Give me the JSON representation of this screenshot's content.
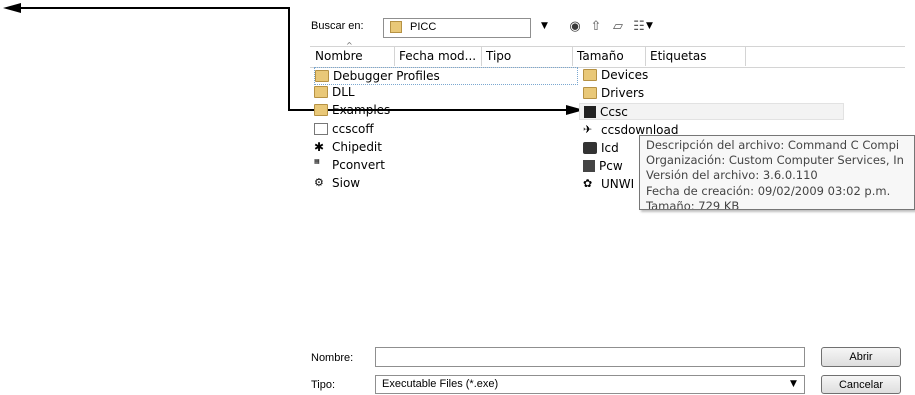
{
  "toolbar": {
    "lookin_label": "Buscar en:",
    "lookin_value": "PICC"
  },
  "columns": [
    "Nombre",
    "Fecha mod...",
    "Tipo",
    "Tamaño",
    "Etiquetas"
  ],
  "files_left": [
    {
      "name": "Debugger Profiles",
      "icon": "folder-icon"
    },
    {
      "name": "DLL",
      "icon": "folder-icon"
    },
    {
      "name": "Examples",
      "icon": "folder-icon"
    },
    {
      "name": "ccscoff",
      "icon": "exe-icon"
    },
    {
      "name": "Chipedit",
      "icon": "chip-icon"
    },
    {
      "name": "Pconvert",
      "icon": "convert-icon"
    },
    {
      "name": "Siow",
      "icon": "serial-icon"
    }
  ],
  "files_right": [
    {
      "name": "Devices",
      "icon": "folder-icon"
    },
    {
      "name": "Drivers",
      "icon": "folder-icon"
    },
    {
      "name": "Ccsc",
      "icon": "app-icon"
    },
    {
      "name": "ccsdownload",
      "icon": "download-icon"
    },
    {
      "name": "Icd",
      "icon": "icd-icon"
    },
    {
      "name": "Pcw",
      "icon": "pcw-icon"
    },
    {
      "name": "UNWI",
      "icon": "uninstall-icon"
    }
  ],
  "tooltip": {
    "line1": "Descripción del archivo: Command C Compi",
    "line2": "Organización: Custom Computer Services, In",
    "line3": "Versión del archivo: 3.6.0.110",
    "line4": "Fecha de creación: 09/02/2009 03:02 p.m.",
    "line5": "Tamaño: 729 KB"
  },
  "footer": {
    "name_label": "Nombre:",
    "name_value": "",
    "type_label": "Tipo:",
    "type_value": "Executable Files (*.exe)",
    "open_button": "Abrir",
    "cancel_button": "Cancelar"
  }
}
